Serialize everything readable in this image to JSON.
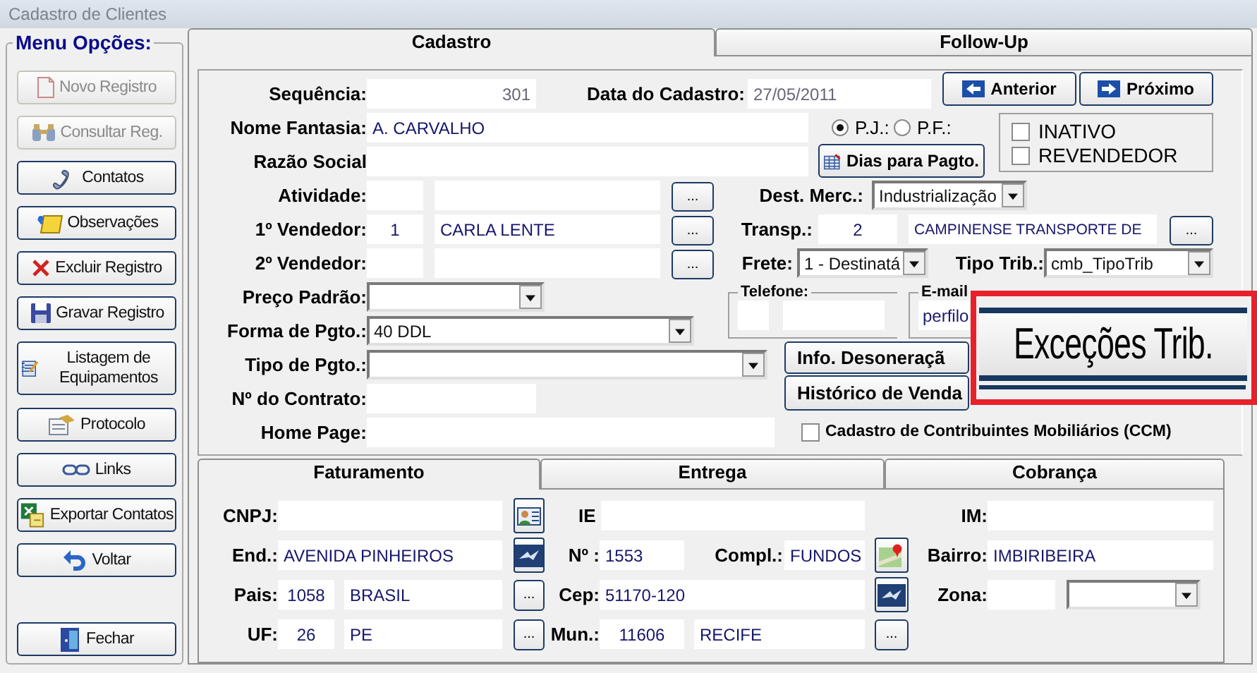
{
  "window": {
    "title": "Cadastro de Clientes"
  },
  "menu": {
    "title": "Menu Opções:",
    "buttons": [
      {
        "label": "Novo Registro",
        "disabled": true
      },
      {
        "label": "Consultar Reg.",
        "disabled": true
      },
      {
        "label": "Contatos",
        "disabled": false
      },
      {
        "label": "Observações",
        "disabled": false
      },
      {
        "label": "Excluir Registro",
        "disabled": false
      },
      {
        "label": "Gravar Registro",
        "disabled": false
      },
      {
        "label": "Listagem de Equipamentos",
        "disabled": false
      },
      {
        "label": "Protocolo",
        "disabled": false
      },
      {
        "label": "Links",
        "disabled": false
      },
      {
        "label": "Exportar Contatos",
        "disabled": false
      },
      {
        "label": "Voltar",
        "disabled": false
      },
      {
        "label": "Fechar",
        "disabled": false
      }
    ]
  },
  "tabs": [
    {
      "label": "Cadastro",
      "selected": true
    },
    {
      "label": "Follow-Up",
      "selected": false
    }
  ],
  "form_rows": [
    [
      {
        "kind": "label",
        "text": "Sequência:"
      },
      {
        "kind": "field",
        "value": "301"
      },
      {
        "kind": "label",
        "text": "Data do Cadastro:"
      },
      {
        "kind": "field",
        "value": "27/05/2011"
      },
      {
        "kind": "button",
        "label": "Anterior"
      },
      {
        "kind": "button",
        "label": "Próximo"
      }
    ],
    [
      {
        "kind": "label",
        "text": "Nome Fantasia:"
      },
      {
        "kind": "field",
        "value": "A. CARVALHO"
      },
      {
        "kind": "radio",
        "label": "P.J.:",
        "selected": true
      },
      {
        "kind": "radio",
        "label": "P.F.:",
        "selected": false
      },
      {
        "kind": "checkgroup",
        "items": [
          {
            "label": "INATIVO",
            "checked": false
          },
          {
            "label": "REVENDEDOR",
            "checked": false
          }
        ]
      }
    ],
    [
      {
        "kind": "label",
        "text": "Razão Social"
      },
      {
        "kind": "field"
      },
      {
        "kind": "button",
        "label": "Dias para Pagto."
      }
    ],
    [
      {
        "kind": "label",
        "text": "Atividade:"
      },
      {
        "kind": "field"
      },
      {
        "kind": "field"
      },
      {
        "kind": "dots",
        "label": "..."
      },
      {
        "kind": "label",
        "text": "Dest. Merc.:"
      },
      {
        "kind": "select",
        "value": "Industrialização"
      }
    ],
    [
      {
        "kind": "label",
        "text": "1º Vendedor:"
      },
      {
        "kind": "field",
        "value": "1"
      },
      {
        "kind": "field",
        "value": "CARLA LENTE"
      },
      {
        "kind": "dots",
        "label": "..."
      },
      {
        "kind": "label",
        "text": "Transp.:"
      },
      {
        "kind": "field",
        "value": "2"
      },
      {
        "kind": "field",
        "value": "CAMPINENSE TRANSPORTE DE"
      },
      {
        "kind": "dots",
        "label": "..."
      }
    ],
    [
      {
        "kind": "label",
        "text": "2º Vendedor:"
      },
      {
        "kind": "field"
      },
      {
        "kind": "field"
      },
      {
        "kind": "dots",
        "label": "..."
      },
      {
        "kind": "label",
        "text": "Frete:"
      },
      {
        "kind": "select",
        "value": "1 - Destinatá"
      },
      {
        "kind": "label",
        "text": "Tipo Trib.:"
      },
      {
        "kind": "select",
        "value": "cmb_TipoTrib"
      }
    ],
    [
      {
        "kind": "label",
        "text": "Preço Padrão:"
      },
      {
        "kind": "select"
      },
      {
        "kind": "fieldset",
        "legend": "Telefone:",
        "items": [
          {
            "kind": "field"
          },
          {
            "kind": "field"
          }
        ]
      },
      {
        "kind": "fieldset",
        "legend": "E-mail",
        "items": [
          {
            "kind": "field",
            "value": "perfilo"
          }
        ]
      }
    ],
    [
      {
        "kind": "label",
        "text": "Forma de Pgto.:"
      },
      {
        "kind": "select",
        "value": "40 DDL"
      }
    ],
    [
      {
        "kind": "label",
        "text": "Tipo de Pgto.:"
      },
      {
        "kind": "select"
      },
      {
        "kind": "button",
        "label": "Info. Desoneraçã"
      }
    ],
    [
      {
        "kind": "label",
        "text": "Nº do Contrato:"
      },
      {
        "kind": "field"
      },
      {
        "kind": "button",
        "label": "Histórico de Venda"
      }
    ],
    [
      {
        "kind": "label",
        "text": "Home Page:"
      },
      {
        "kind": "field"
      },
      {
        "kind": "checkbox",
        "label": "Cadastro de Contribuintes Mobiliários (CCM)",
        "checked": false
      }
    ]
  ],
  "address_tabs": [
    {
      "label": "Faturamento",
      "selected": true
    },
    {
      "label": "Entrega",
      "selected": false
    },
    {
      "label": "Cobrança",
      "selected": false
    }
  ],
  "address_rows": [
    [
      {
        "kind": "label",
        "text": "CNPJ:"
      },
      {
        "kind": "field"
      },
      {
        "kind": "iconbutton"
      },
      {
        "kind": "label",
        "text": "IE"
      },
      {
        "kind": "field"
      },
      {
        "kind": "label",
        "text": "IM:"
      },
      {
        "kind": "field"
      }
    ],
    [
      {
        "kind": "label",
        "text": "End.:"
      },
      {
        "kind": "field",
        "value": "AVENIDA PINHEIROS"
      },
      {
        "kind": "iconbutton"
      },
      {
        "kind": "label",
        "text": "Nº :"
      },
      {
        "kind": "field",
        "value": "1553"
      },
      {
        "kind": "label",
        "text": "Compl.:"
      },
      {
        "kind": "field",
        "value": "FUNDOS"
      },
      {
        "kind": "iconbutton"
      },
      {
        "kind": "label",
        "text": "Bairro:"
      },
      {
        "kind": "field",
        "value": "IMBIRIBEIRA"
      }
    ],
    [
      {
        "kind": "label",
        "text": "Pais:"
      },
      {
        "kind": "field",
        "value": "1058"
      },
      {
        "kind": "field",
        "value": "BRASIL"
      },
      {
        "kind": "dots",
        "label": "..."
      },
      {
        "kind": "label",
        "text": "Cep:"
      },
      {
        "kind": "field",
        "value": "51170-120"
      },
      {
        "kind": "iconbutton"
      },
      {
        "kind": "label",
        "text": "Zona:"
      },
      {
        "kind": "field"
      },
      {
        "kind": "select"
      }
    ],
    [
      {
        "kind": "label",
        "text": "UF:"
      },
      {
        "kind": "field",
        "value": "26"
      },
      {
        "kind": "field",
        "value": "PE"
      },
      {
        "kind": "dots",
        "label": "..."
      },
      {
        "kind": "label",
        "text": "Mun.:"
      },
      {
        "kind": "field",
        "value": "11606"
      },
      {
        "kind": "field",
        "value": "RECIFE"
      },
      {
        "kind": "dots",
        "label": "..."
      }
    ]
  ],
  "zoom_callout": {
    "label": "Exceções Trib."
  }
}
